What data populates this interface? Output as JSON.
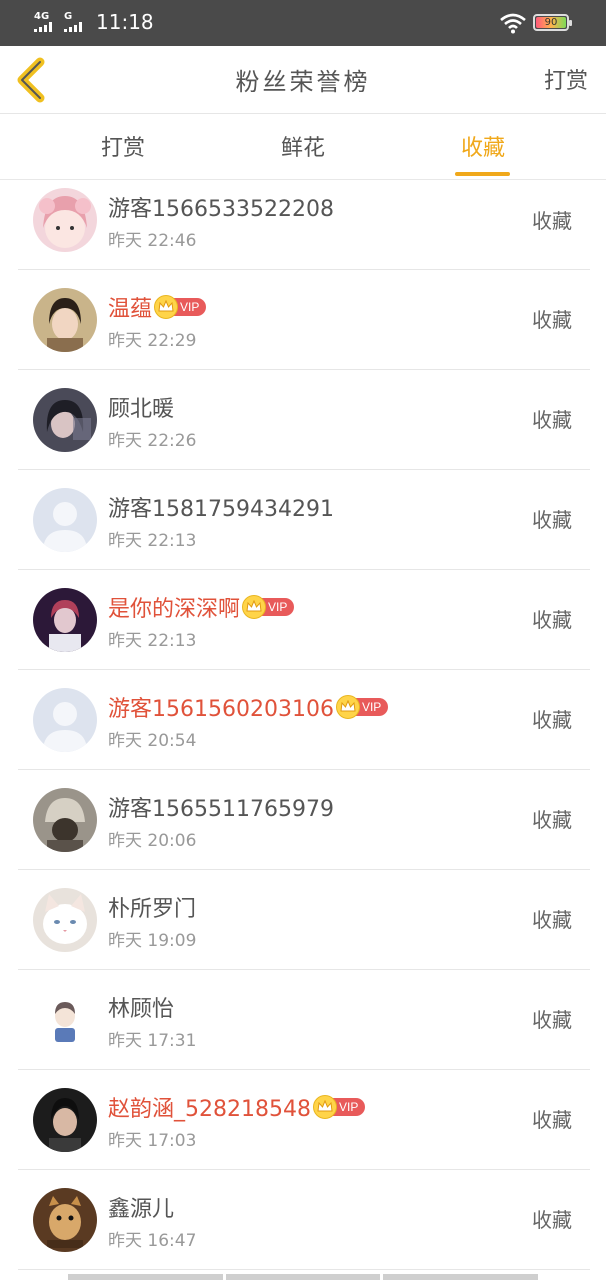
{
  "status_bar": {
    "net1": "4G",
    "net2": "G",
    "time": "11:18",
    "battery": "90"
  },
  "header": {
    "title": "粉丝荣誉榜",
    "action": "打赏"
  },
  "tabs": [
    {
      "label": "打赏",
      "active": false
    },
    {
      "label": "鲜花",
      "active": false
    },
    {
      "label": "收藏",
      "active": true
    }
  ],
  "colors": {
    "accent": "#f0a81a",
    "vip_name": "#e0523a",
    "vip_badge": "#e85a5a",
    "status_bar": "#4a4a4a"
  },
  "vip_label": "VIP",
  "fans": [
    {
      "name": "游客1566533522208",
      "time": "昨天 22:46",
      "vip": false,
      "tag": "收藏",
      "avatar": "avatar-girl-pink"
    },
    {
      "name": "温蕴",
      "time": "昨天 22:29",
      "vip": true,
      "tag": "收藏",
      "avatar": "avatar-girl-brown"
    },
    {
      "name": "顾北暖",
      "time": "昨天 22:26",
      "vip": false,
      "tag": "收藏",
      "avatar": "avatar-girl-dark"
    },
    {
      "name": "游客1581759434291",
      "time": "昨天 22:13",
      "vip": false,
      "tag": "收藏",
      "avatar": "avatar-default"
    },
    {
      "name": "是你的深深啊",
      "time": "昨天 22:13",
      "vip": true,
      "tag": "收藏",
      "avatar": "avatar-boy-purple"
    },
    {
      "name": "游客1561560203106",
      "time": "昨天 20:54",
      "vip": true,
      "tag": "收藏",
      "avatar": "avatar-default"
    },
    {
      "name": "游客1565511765979",
      "time": "昨天 20:06",
      "vip": false,
      "tag": "收藏",
      "avatar": "avatar-hat-gray"
    },
    {
      "name": "朴所罗门",
      "time": "昨天 19:09",
      "vip": false,
      "tag": "收藏",
      "avatar": "avatar-cat"
    },
    {
      "name": "林顾怡",
      "time": "昨天 17:31",
      "vip": false,
      "tag": "收藏",
      "avatar": "avatar-cartoon"
    },
    {
      "name": "赵韵涵_528218548",
      "time": "昨天 17:03",
      "vip": true,
      "tag": "收藏",
      "avatar": "avatar-boy-dark"
    },
    {
      "name": "鑫源儿",
      "time": "昨天 16:47",
      "vip": false,
      "tag": "收藏",
      "avatar": "avatar-squirrel"
    }
  ]
}
